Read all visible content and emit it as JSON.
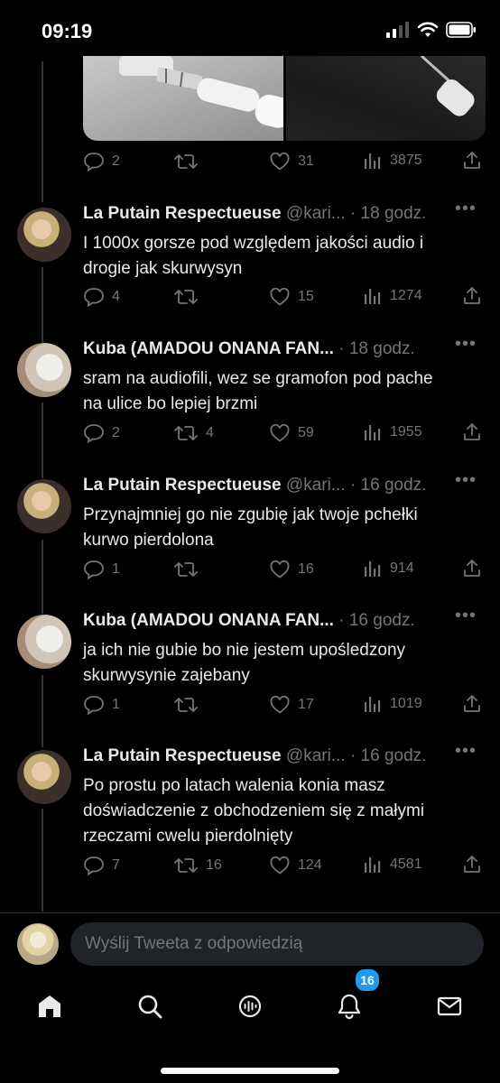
{
  "status_bar": {
    "time": "09:19"
  },
  "first_tweet_actions": {
    "replies": "2",
    "retweets": "",
    "likes": "31",
    "views": "3875"
  },
  "tweets": [
    {
      "name": "La Putain Respectueuse",
      "handle": "@kari...",
      "time": "· 18 godz.",
      "lines": [
        "I 1000x gorsze pod względem jakości audio i",
        "drogie jak skurwysyn"
      ],
      "replies": "4",
      "retweets": "",
      "likes": "15",
      "views": "1274"
    },
    {
      "name": "Kuba (AMADOU ONANA FAN...",
      "handle": "",
      "time": "· 18 godz.",
      "lines": [
        "sram na audiofili, wez se gramofon pod pache",
        "na ulice bo lepiej brzmi"
      ],
      "replies": "2",
      "retweets": "4",
      "likes": "59",
      "views": "1955"
    },
    {
      "name": "La Putain Respectueuse",
      "handle": "@kari...",
      "time": "· 16 godz.",
      "lines": [
        "Przynajmniej go nie zgubię jak twoje pchełki",
        "kurwo pierdolona"
      ],
      "replies": "1",
      "retweets": "",
      "likes": "16",
      "views": "914"
    },
    {
      "name": "Kuba (AMADOU ONANA FAN...",
      "handle": "",
      "time": "· 16 godz.",
      "lines": [
        "ja ich nie gubie bo nie jestem upośledzony",
        "skurwysynie zajebany"
      ],
      "replies": "1",
      "retweets": "",
      "likes": "17",
      "views": "1019"
    },
    {
      "name": "La Putain Respectueuse",
      "handle": "@kari...",
      "time": "· 16 godz.",
      "lines": [
        "Po prostu po latach walenia konia masz",
        "doświadczenie z obchodzeniem się z małymi",
        "rzeczami cwelu pierdolnięty"
      ],
      "replies": "7",
      "retweets": "16",
      "likes": "124",
      "views": "4581"
    }
  ],
  "composer": {
    "placeholder": "Wyślij Tweeta z odpowiedzią"
  },
  "tabbar": {
    "notifications_badge": "16"
  },
  "colors": {
    "background": "#000000",
    "muted": "#71767b",
    "accent": "#1d9bf0",
    "text": "#e7e9ea"
  },
  "icons": [
    "reply-icon",
    "retweet-icon",
    "like-icon",
    "views-icon",
    "share-icon",
    "home-icon",
    "search-icon",
    "spaces-icon",
    "notifications-icon",
    "messages-icon"
  ]
}
